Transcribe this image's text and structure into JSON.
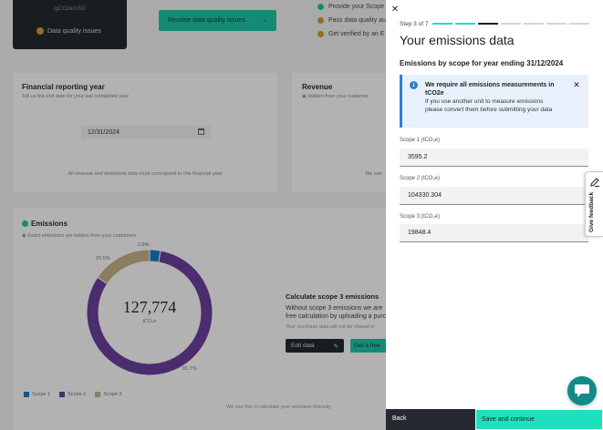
{
  "background": {
    "dark_card_title": "tgCO2e/USD",
    "data_quality_label": "Data quality issues",
    "resolve_button": "Resolve data quality issues",
    "steps": [
      {
        "label": "Provide your Scope",
        "color": "#1ec8a8"
      },
      {
        "label": "Pass data quality au",
        "color": "#d99b2b"
      },
      {
        "label": "Get verified by an E",
        "color": "#d99b2b"
      }
    ],
    "financial": {
      "title": "Financial reporting year",
      "subtitle": "Tell us the end date for your last completed year",
      "date_value": "12/31/2024",
      "footer": "All revenue and emissions data must correspond to this financial year"
    },
    "revenue": {
      "title": "Revenue",
      "subtitle": "Hidden from your customer",
      "footer": "We use"
    },
    "emissions": {
      "title": "Emissions",
      "subtitle": "Exact emissions are hidden from your customers",
      "total": "127,774",
      "unit": "tCO₂e",
      "footer": "We use this to calculate your emission intensity",
      "legend": [
        "Scope 1",
        "Scope 2",
        "Scope 3"
      ]
    },
    "calculate": {
      "title": "Calculate scope 3 emissions",
      "text": "Without scope 3 emissions we are free calculation by uploading a purc",
      "note": "Your purchase data will not be shared w",
      "edit_button": "Edit data",
      "free_button": "Get a free"
    }
  },
  "chart_data": {
    "type": "pie",
    "categories": [
      "Scope 1",
      "Scope 2",
      "Scope 3"
    ],
    "values": [
      3595.2,
      104330.304,
      19848.4
    ],
    "percent_labels": [
      "2.8%",
      "81.7%",
      "15.5%"
    ],
    "colors": [
      "#1a7bc4",
      "#6b3fa0",
      "#c7b38a"
    ],
    "center_label": "127,774",
    "center_unit": "tCO₂e"
  },
  "drawer": {
    "step_label": "Step 3 of 7",
    "progress": {
      "current": 3,
      "total": 7
    },
    "title": "Your emissions data",
    "section_title": "Emissions by scope for year ending 31/12/2024",
    "notice": {
      "heading": "We require all emissions measurements in tCO2e",
      "body": "If you use another unit to measure emissions please convert them before submitting your data"
    },
    "fields": [
      {
        "label": "Scope 1 (tCO₂e)",
        "value": "3595.2"
      },
      {
        "label": "Scope 2 (tCO₂e)",
        "value": "104330.304"
      },
      {
        "label": "Scope 3 (tCO₂e)",
        "value": "19848.4"
      }
    ],
    "back_button": "Back",
    "save_button": "Save and continue"
  },
  "feedback_tab": "Give feedback",
  "colors": {
    "accent": "#1ee0bf",
    "progress_done": "#1ee0bf",
    "progress_current": "#1e1e1e",
    "progress_todo": "#d5d5d5",
    "dark": "#252a30",
    "info": "#2f80d1"
  }
}
